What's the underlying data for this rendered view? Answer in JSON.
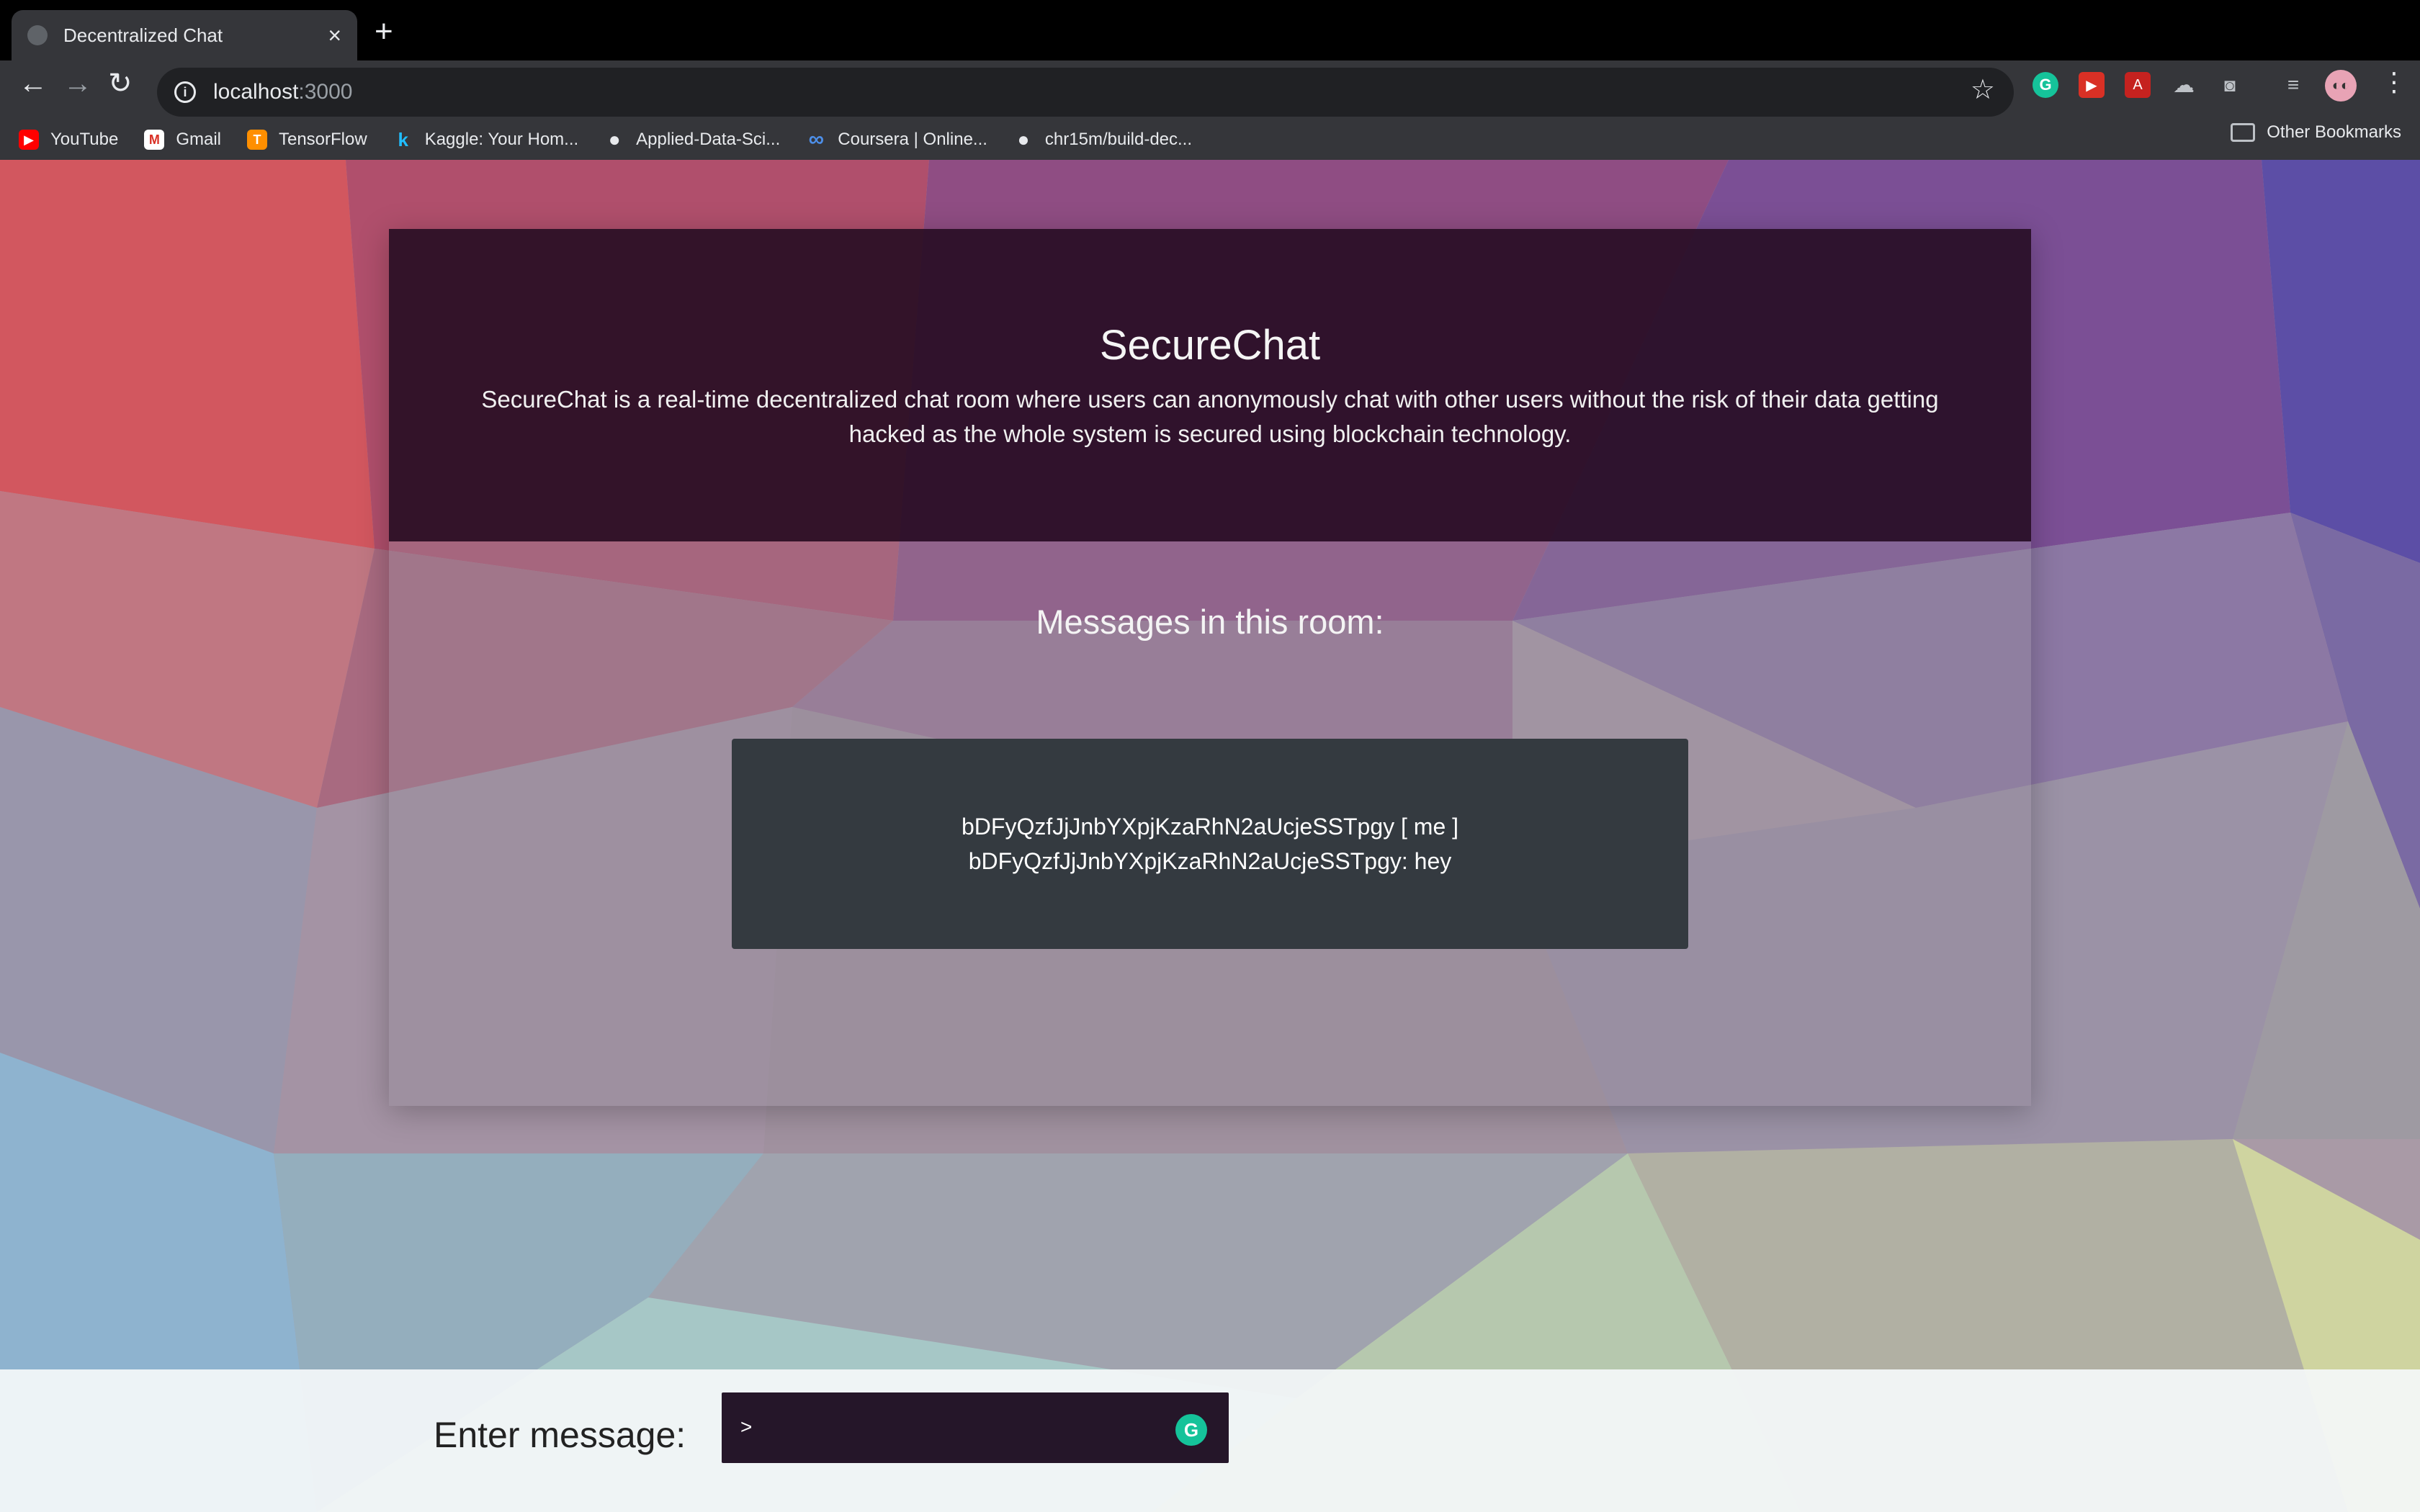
{
  "browser": {
    "tab_title": "Decentralized Chat",
    "tab_close": "×",
    "new_tab": "+",
    "url_host": "localhost",
    "url_port": ":3000",
    "nav": {
      "back": "←",
      "forward": "→",
      "reload": "↻"
    },
    "star": "☆",
    "menu": "⋮",
    "bookmarks": [
      {
        "label": "YouTube",
        "icon": "youtube-icon",
        "color": "#ff0000",
        "glyph": "▶"
      },
      {
        "label": "Gmail",
        "icon": "gmail-icon",
        "color": "#d93025",
        "glyph": "M"
      },
      {
        "label": "TensorFlow",
        "icon": "tensorflow-icon",
        "color": "#ff8f00",
        "glyph": "T"
      },
      {
        "label": "Kaggle: Your Hom...",
        "icon": "kaggle-icon",
        "color": "#20beff",
        "glyph": "k"
      },
      {
        "label": "Applied-Data-Sci...",
        "icon": "github-icon",
        "color": "#e8eaed",
        "glyph": "●"
      },
      {
        "label": "Coursera | Online...",
        "icon": "coursera-icon",
        "color": "#2a73cc",
        "glyph": "∞"
      },
      {
        "label": "chr15m/build-dec...",
        "icon": "github-icon",
        "color": "#e8eaed",
        "glyph": "●"
      }
    ],
    "other_bookmarks": "Other Bookmarks"
  },
  "hero": {
    "title": "SecureChat",
    "description": "SecureChat is a real-time decentralized chat room where users can anonymously chat with other users without the risk of their data getting hacked as the whole system is secured using blockchain technology."
  },
  "messages": {
    "heading": "Messages in this room:",
    "lines": [
      "bDFyQzfJjJnbYXpjKzaRhN2aUcjeSSTpgy [ me ]",
      "bDFyQzfJjJnbYXpjKzaRhN2aUcjeSSTpgy: hey"
    ]
  },
  "composer": {
    "label": "Enter message:",
    "prompt": ">",
    "value": ""
  },
  "colors": {
    "hero_bg": "#260c22",
    "message_box": "#343a40",
    "input_bg": "#251629",
    "grammarly": "#15c39a"
  }
}
